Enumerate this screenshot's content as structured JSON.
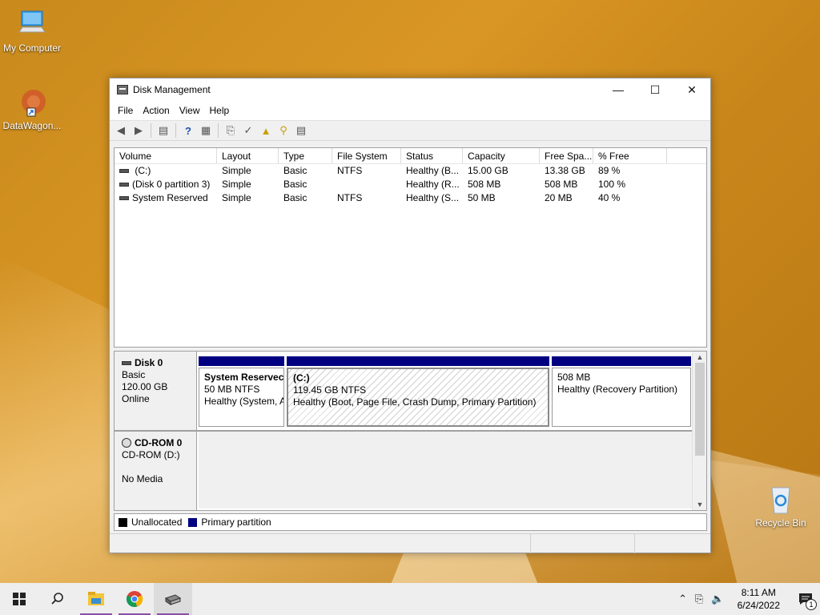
{
  "desktop": {
    "icons": [
      {
        "label": "My Computer"
      },
      {
        "label": "DataWagon..."
      },
      {
        "label": "Recycle Bin"
      }
    ]
  },
  "window": {
    "title": "Disk Management",
    "menu": [
      "File",
      "Action",
      "View",
      "Help"
    ],
    "columns": [
      "Volume",
      "Layout",
      "Type",
      "File System",
      "Status",
      "Capacity",
      "Free Spa...",
      "% Free"
    ],
    "volumes": [
      {
        "volume": " (C:)",
        "layout": "Simple",
        "type": "Basic",
        "fs": "NTFS",
        "status": "Healthy (B...",
        "capacity": "15.00 GB",
        "free": "13.38 GB",
        "pct": "89 %"
      },
      {
        "volume": "(Disk 0 partition 3)",
        "layout": "Simple",
        "type": "Basic",
        "fs": "",
        "status": "Healthy (R...",
        "capacity": "508 MB",
        "free": "508 MB",
        "pct": "100 %"
      },
      {
        "volume": "System Reserved",
        "layout": "Simple",
        "type": "Basic",
        "fs": "NTFS",
        "status": "Healthy (S...",
        "capacity": "50 MB",
        "free": "20 MB",
        "pct": "40 %"
      }
    ],
    "disks": [
      {
        "name": "Disk 0",
        "line1": "Basic",
        "line2": "120.00 GB",
        "line3": "Online",
        "partitions": [
          {
            "name": "System Reservec",
            "size": "50 MB NTFS",
            "status": "Healthy (System, A"
          },
          {
            "name": "(C:)",
            "size": "119.45 GB NTFS",
            "status": "Healthy (Boot, Page File, Crash Dump, Primary Partition)"
          },
          {
            "name": "",
            "size": "508 MB",
            "status": "Healthy (Recovery Partition)"
          }
        ]
      },
      {
        "name": "CD-ROM 0",
        "line1": "CD-ROM (D:)",
        "line2": "",
        "line3": "No Media"
      }
    ],
    "legend": [
      {
        "label": "Unallocated",
        "color": "#000000"
      },
      {
        "label": "Primary partition",
        "color": "#000080"
      }
    ]
  },
  "taskbar": {
    "time": "8:11 AM",
    "date": "6/24/2022",
    "notification_count": "1"
  }
}
